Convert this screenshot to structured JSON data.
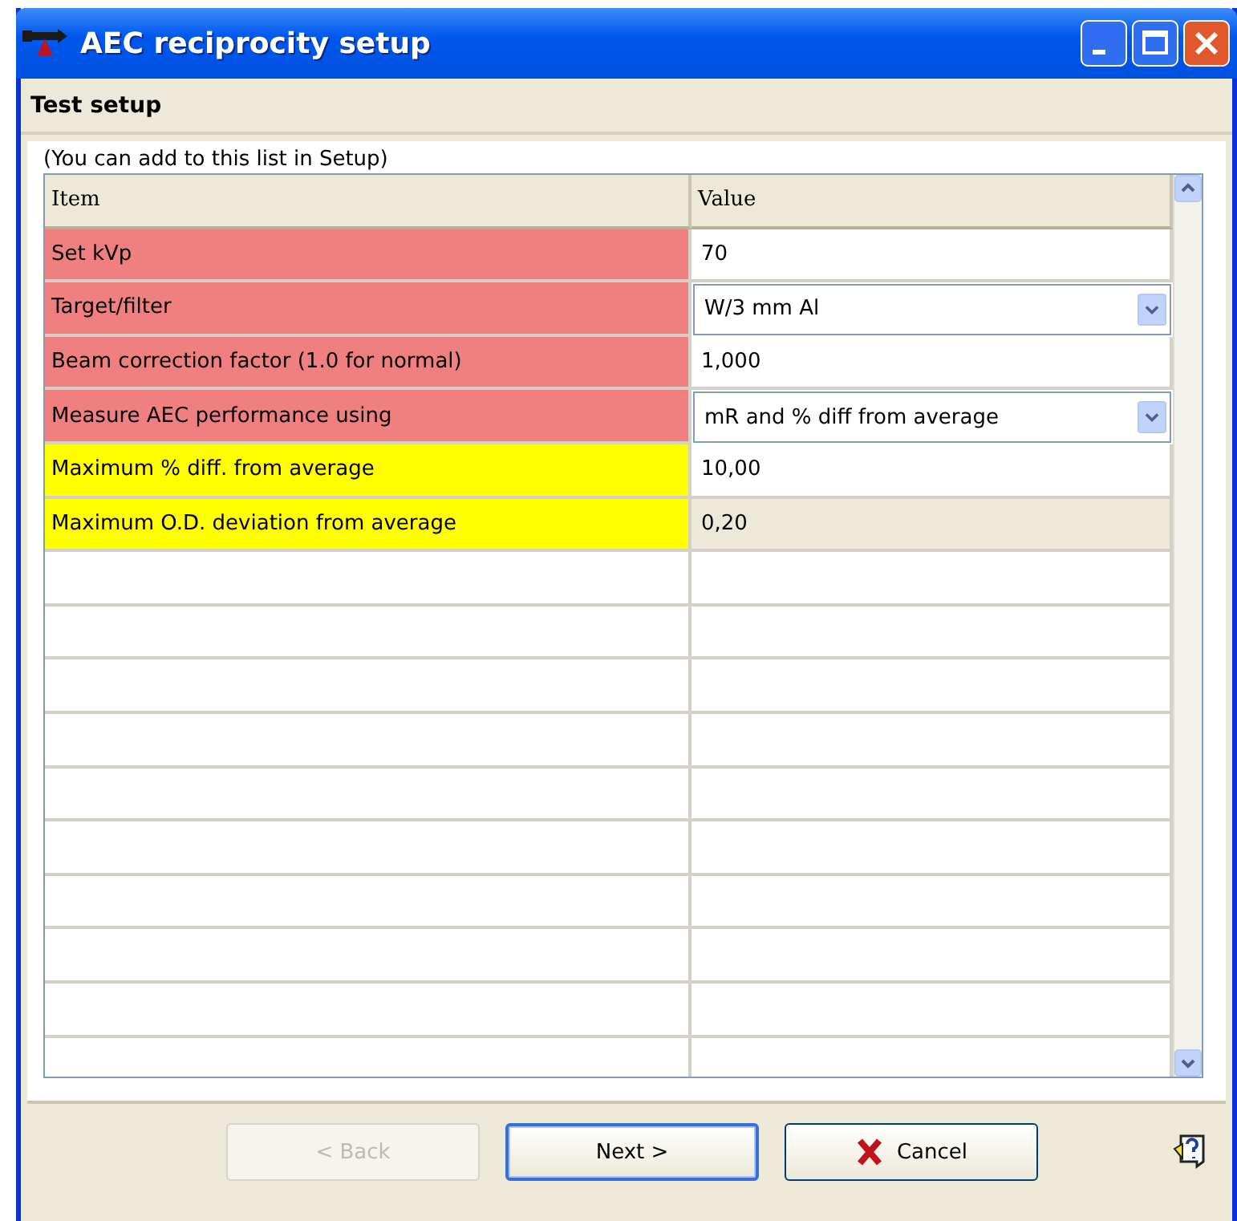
{
  "window": {
    "title": "AEC reciprocity setup"
  },
  "header": {
    "title": "Test setup"
  },
  "hint": "(You can add to this list in Setup)",
  "table": {
    "columns": [
      "Item",
      "Value"
    ],
    "rows": [
      {
        "item": "Set kVp",
        "value": "70",
        "kind": "text",
        "color": "#f08080",
        "selected": false
      },
      {
        "item": "Target/filter",
        "value": "W/3 mm Al",
        "kind": "dropdown",
        "color": "#f08080",
        "selected": false
      },
      {
        "item": "Beam correction factor (1.0 for normal)",
        "value": "1,000",
        "kind": "text",
        "color": "#f08080",
        "selected": false
      },
      {
        "item": "Measure AEC performance using",
        "value": "mR and % diff from average",
        "kind": "dropdown",
        "color": "#f08080",
        "selected": false
      },
      {
        "item": "Maximum % diff. from average",
        "value": "10,00",
        "kind": "text",
        "color": "#ffff00",
        "selected": false
      },
      {
        "item": "Maximum O.D. deviation from average",
        "value": "0,20",
        "kind": "text",
        "color": "#ffff00",
        "selected": true
      }
    ]
  },
  "buttons": [
    {
      "label": "< Back",
      "disabled": true,
      "default": false,
      "kind": "plain"
    },
    {
      "label": "Next >",
      "disabled": false,
      "default": true,
      "kind": "plain"
    },
    {
      "label": "Cancel",
      "disabled": false,
      "default": false,
      "kind": "cancel"
    }
  ]
}
